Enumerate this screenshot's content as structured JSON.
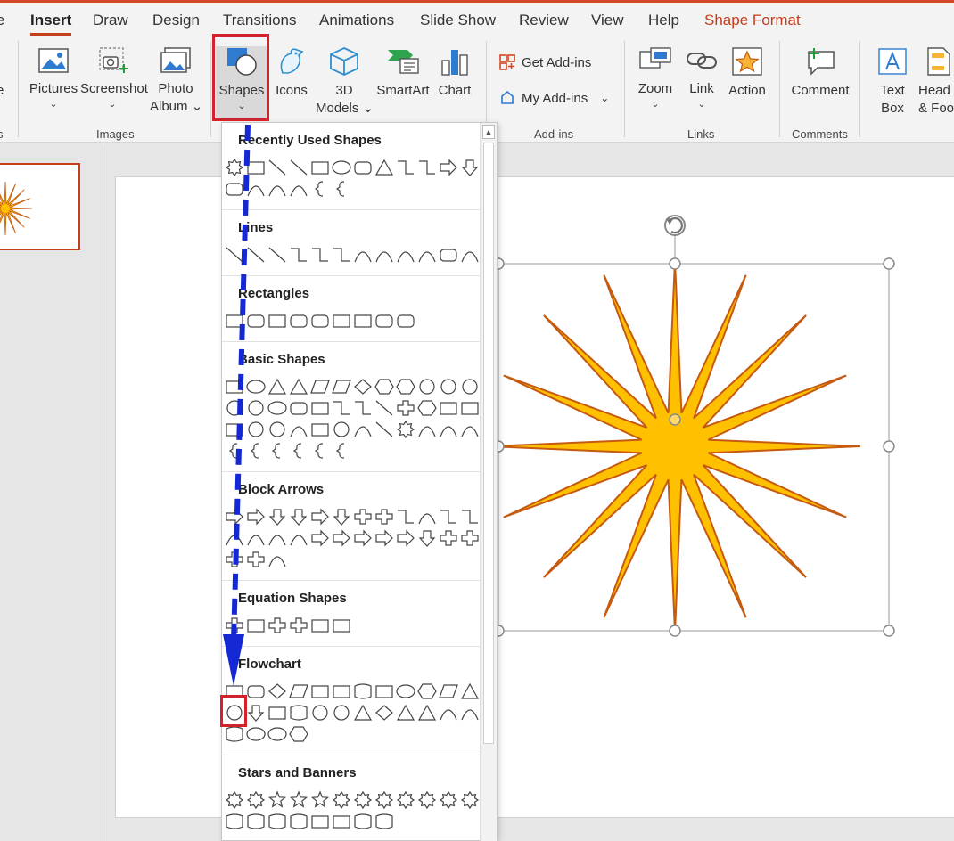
{
  "tabs": [
    "le",
    "Insert",
    "Draw",
    "Design",
    "Transitions",
    "Animations",
    "Slide Show",
    "Review",
    "View",
    "Help",
    "Shape Format"
  ],
  "active_tab": "Insert",
  "contextual_tab": "Shape Format",
  "ribbon": {
    "partial_left_label": "e",
    "pictures": "Pictures",
    "screenshot": "Screenshot",
    "photo_album": "Photo",
    "photo_album2": "Album",
    "shapes": "Shapes",
    "icons": "Icons",
    "models": "3D",
    "models2": "Models",
    "smartart": "SmartArt",
    "chart": "Chart",
    "get_addins": "Get Add-ins",
    "my_addins": "My Add-ins",
    "zoom": "Zoom",
    "link": "Link",
    "action": "Action",
    "comment": "Comment",
    "textbox": "Text",
    "textbox2": "Box",
    "header": "Head",
    "header2": "& Foo"
  },
  "groups": {
    "left_partial": "s",
    "images": "Images",
    "addins": "Add-ins",
    "links": "Links",
    "comments": "Comments"
  },
  "gallery": {
    "sections": [
      "Recently Used Shapes",
      "Lines",
      "Rectangles",
      "Basic Shapes",
      "Block Arrows",
      "Equation Shapes",
      "Flowchart",
      "Stars and Banners"
    ],
    "basic_num_labels": [
      "7",
      "8",
      "10",
      "12"
    ],
    "star_labels": [
      "8",
      "10",
      "12",
      "16",
      "24",
      "32"
    ]
  },
  "colors": {
    "accent": "#c43e1c",
    "highlight_box": "#d2232a",
    "arrow": "#1428d6",
    "star_fill": "#ffc000",
    "star_stroke": "#c55a11"
  }
}
